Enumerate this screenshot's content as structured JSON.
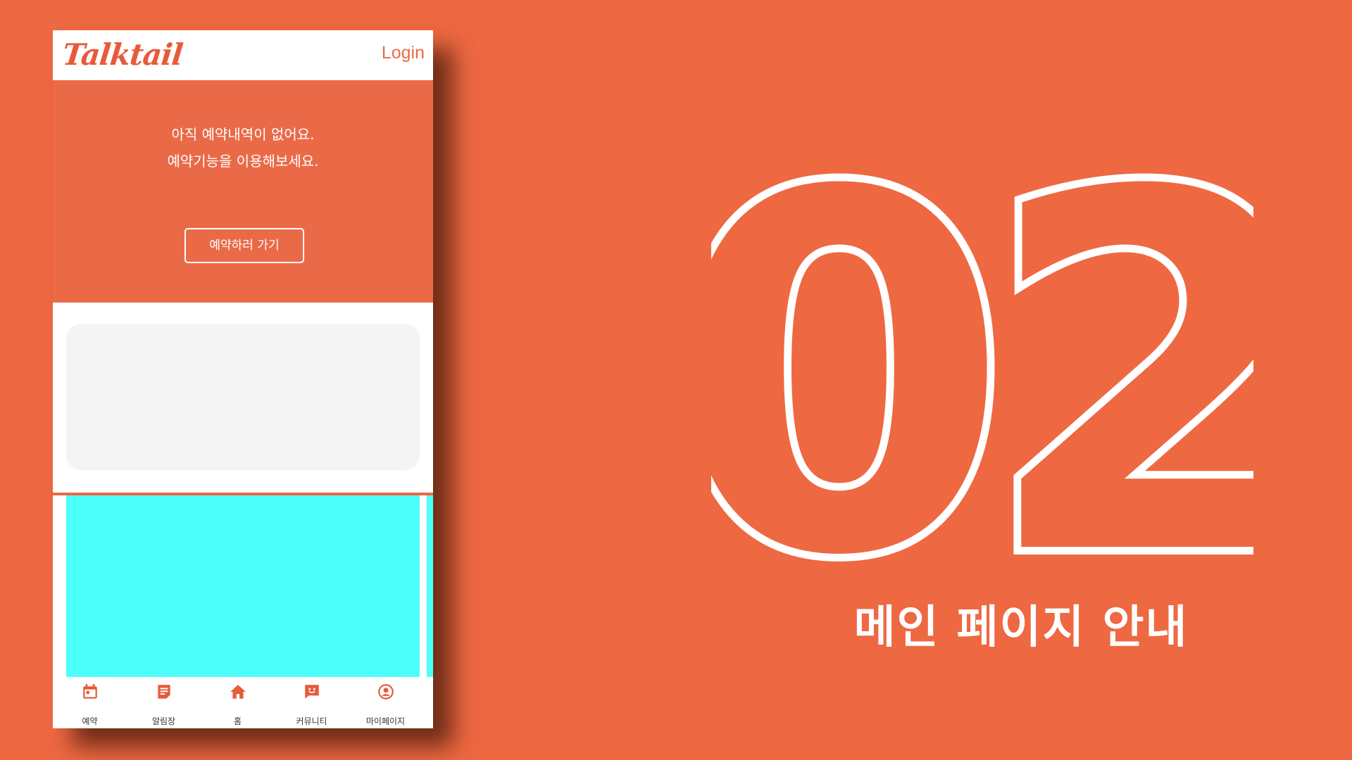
{
  "app": {
    "logo": "Talktail",
    "login_label": "Login"
  },
  "hero": {
    "line1": "아직 예약내역이 없어요.",
    "line2": "예약기능을 이용해보세요.",
    "button_label": "예약하러 가기"
  },
  "tabs": [
    {
      "label": "예약",
      "icon": "calendar-icon"
    },
    {
      "label": "알림장",
      "icon": "note-icon"
    },
    {
      "label": "홈",
      "icon": "home-icon"
    },
    {
      "label": "커뮤니티",
      "icon": "chat-icon"
    },
    {
      "label": "마이페이지",
      "icon": "profile-icon"
    }
  ],
  "slide": {
    "number": "02",
    "title": "메인 페이지 안내"
  },
  "colors": {
    "background": "#EE6842",
    "hero": "#EA6A48",
    "accent": "#E85A3A",
    "banner": "#4CFFFA",
    "card": "#F4F4F4"
  }
}
